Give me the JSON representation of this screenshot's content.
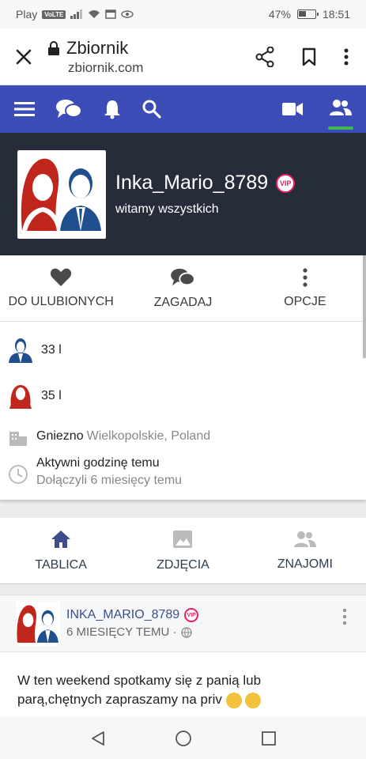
{
  "status": {
    "carrier": "Play",
    "network_badge": "VoLTE",
    "battery": "47%",
    "time": "18:51"
  },
  "browser": {
    "title": "Zbiornik",
    "url": "zbiornik.com"
  },
  "nav": {
    "accent": "#3d4db7",
    "active_tab": "users-icon"
  },
  "profile": {
    "username": "Inka_Mario_8789",
    "badge": "VIP",
    "tagline": "witamy wszystkich"
  },
  "actions": [
    {
      "label": "DO ULUBIONYCH",
      "icon": "heart-icon"
    },
    {
      "label": "ZAGADAJ",
      "icon": "chat-icon"
    },
    {
      "label": "OPCJE",
      "icon": "more-vertical-icon"
    }
  ],
  "details": {
    "male_age": "33 l",
    "female_age": "35 l",
    "city": "Gniezno",
    "region": "Wielkopolskie, Poland",
    "active": "Aktywni godzinę temu",
    "joined": "Dołączyli 6 miesięcy temu"
  },
  "tabs": [
    {
      "label": "TABLICA",
      "icon": "home-icon"
    },
    {
      "label": "ZDJĘCIA",
      "icon": "image-icon"
    },
    {
      "label": "ZNAJOMI",
      "icon": "friends-icon"
    }
  ],
  "post": {
    "author": "INKA_MARIO_8789",
    "badge": "VIP",
    "time": "6 MIESIĘCY TEMU ·",
    "text": "W ten weekend spotkamy się z panią lub parą,chętnych zapraszamy na priv"
  }
}
